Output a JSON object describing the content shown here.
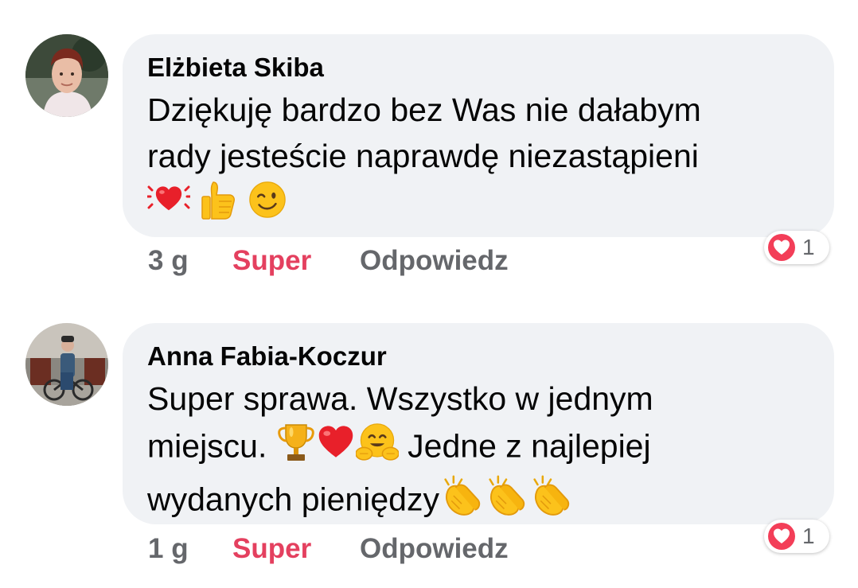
{
  "comments": [
    {
      "author": "Elżbieta Skiba",
      "lines": [
        "Dziękuję bardzo bez Was nie dałabym",
        "rady jesteście naprawdę niezastąpieni"
      ],
      "emoji_line": [
        "vibrating-heart",
        "thumbs-up",
        "winking-face"
      ],
      "time": "3 g",
      "like_label": "Super",
      "reply_label": "Odpowiedz",
      "reaction_count": "1",
      "reaction_icon": "heart-reaction",
      "like_color": "#e4405f"
    },
    {
      "author": "Anna Fabia-Koczur",
      "line1_text": "Super sprawa. Wszystko w jednym",
      "line2_pre": "miejscu. ",
      "line2_emojis": [
        "trophy",
        "red-heart",
        "hugging-face"
      ],
      "line2_post": " Jedne z najlepiej",
      "line3_text": "wydanych pieniędzy",
      "line3_emojis": [
        "clapping-hands",
        "clapping-hands",
        "clapping-hands"
      ],
      "time": "1 g",
      "like_label": "Super",
      "reply_label": "Odpowiedz",
      "reaction_count": "1",
      "reaction_icon": "heart-reaction"
    }
  ],
  "colors": {
    "bubble_bg": "#f0f2f5",
    "text": "#050505",
    "meta": "#65676b",
    "like": "#e4405f",
    "reaction": "#f33e58"
  }
}
